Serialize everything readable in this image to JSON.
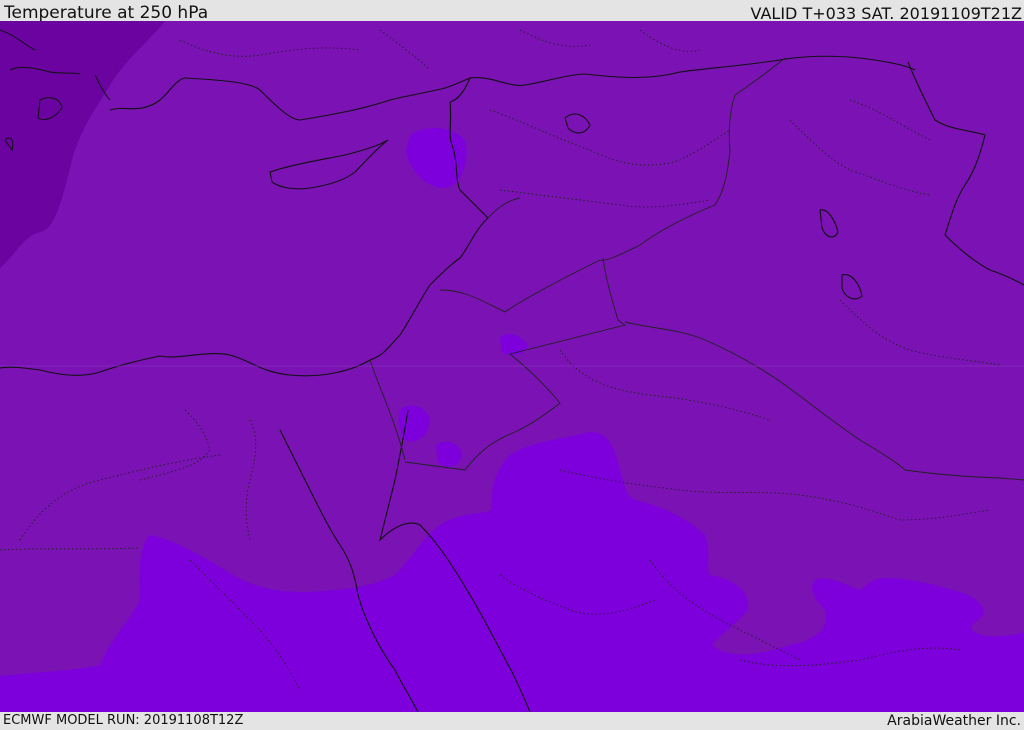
{
  "header": {
    "title": "Temperature at 250 hPa",
    "valid": "VALID T+033 SAT. 20191109T21Z"
  },
  "footer": {
    "model_run": "ECMWF MODEL RUN: 20191108T12Z",
    "credit": "ArabiaWeather Inc."
  },
  "map": {
    "colors": {
      "cold_band": "#6a03a0",
      "mid_band": "#7a12b4",
      "warm_band": "#7d00dc",
      "coastline": "#111111",
      "border": "#222222"
    }
  }
}
